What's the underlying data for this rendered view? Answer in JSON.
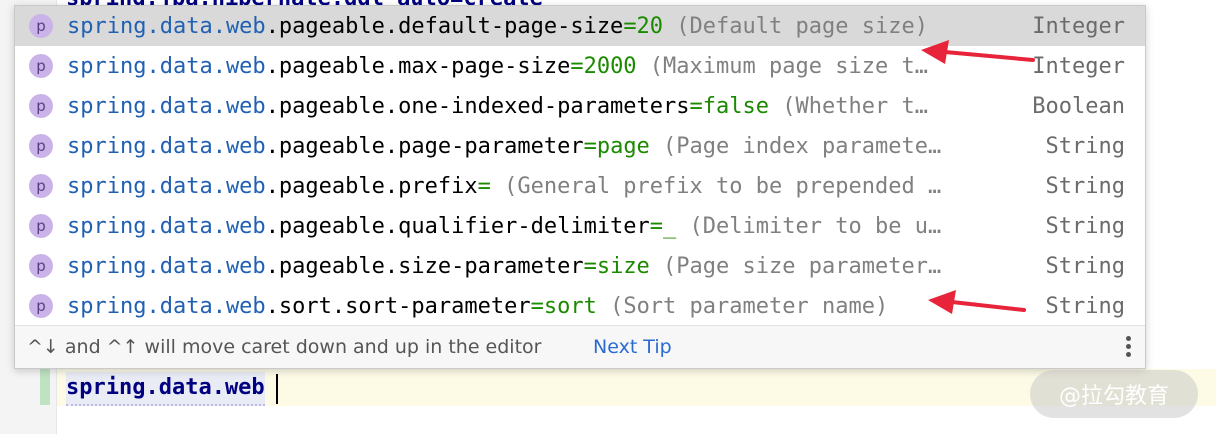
{
  "editor": {
    "top_line": "spring.jpa.hibernate.ddl-auto=create",
    "typed_text": "spring.data.web"
  },
  "popup": {
    "items": [
      {
        "badge": "p",
        "prefix": "spring.data.web",
        "name": ".pageable.default-page-size",
        "value": "=20",
        "desc": " (Default page size)",
        "type": "Integer"
      },
      {
        "badge": "p",
        "prefix": "spring.data.web",
        "name": ".pageable.max-page-size",
        "value": "=2000",
        "desc": " (Maximum page size t…",
        "type": "Integer"
      },
      {
        "badge": "p",
        "prefix": "spring.data.web",
        "name": ".pageable.one-indexed-parameters",
        "value": "=false",
        "desc": " (Whether t…",
        "type": "Boolean"
      },
      {
        "badge": "p",
        "prefix": "spring.data.web",
        "name": ".pageable.page-parameter",
        "value": "=page",
        "desc": " (Page index paramete…",
        "type": "String"
      },
      {
        "badge": "p",
        "prefix": "spring.data.web",
        "name": ".pageable.prefix",
        "value": "=",
        "desc": " (General prefix to be prepended …",
        "type": "String"
      },
      {
        "badge": "p",
        "prefix": "spring.data.web",
        "name": ".pageable.qualifier-delimiter",
        "value": "=_",
        "desc": " (Delimiter to be u…",
        "type": "String"
      },
      {
        "badge": "p",
        "prefix": "spring.data.web",
        "name": ".pageable.size-parameter",
        "value": "=size",
        "desc": " (Page size parameter…",
        "type": "String"
      },
      {
        "badge": "p",
        "prefix": "spring.data.web",
        "name": ".sort.sort-parameter",
        "value": "=sort",
        "desc": " (Sort parameter name)",
        "type": "String"
      }
    ],
    "footer_hint": "^↓ and ^↑ will move caret down and up in the editor",
    "next_tip": "Next Tip"
  },
  "watermark": "@拉勾教育",
  "colors": {
    "prefix": "#2161b3",
    "value": "#1b8a00",
    "arrow": "#e8243a",
    "badge": "#c9b3e8"
  }
}
